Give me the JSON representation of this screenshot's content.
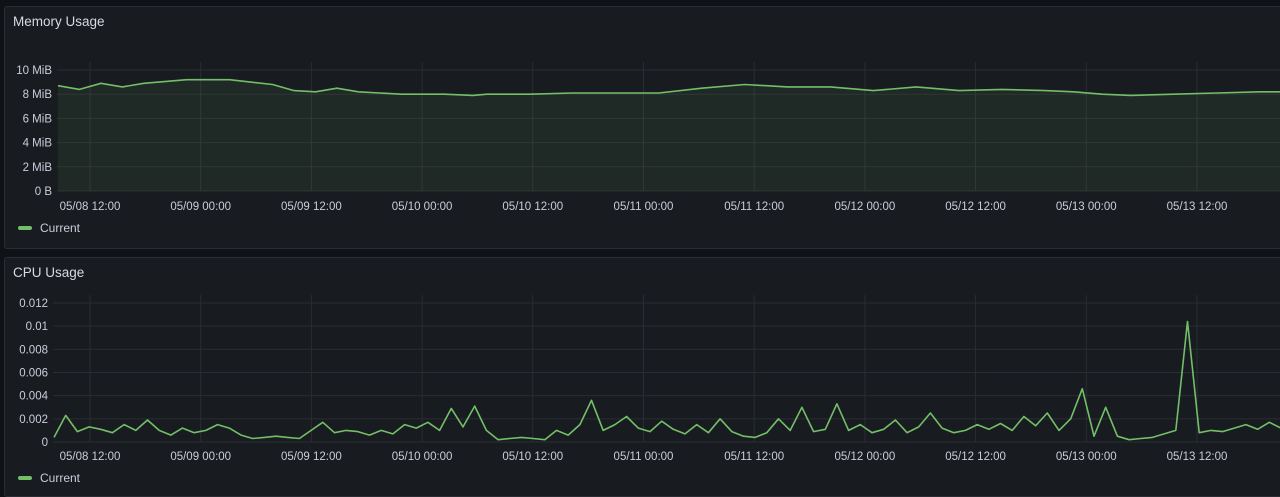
{
  "colors": {
    "series": "#73bf69",
    "grid": "#2a2d33",
    "background": "#181b1f"
  },
  "panels": {
    "memory": {
      "title": "Memory Usage",
      "legend": "Current",
      "chart_data": {
        "type": "area",
        "title": "Memory Usage",
        "series": [
          {
            "name": "Current",
            "x_hours": [
              0,
              3,
              6,
              9,
              12,
              18,
              24,
              30,
              33,
              36,
              39,
              42,
              48,
              54,
              58,
              60,
              66,
              72,
              78,
              84,
              90,
              96,
              102,
              108,
              114,
              120,
              126,
              132,
              138,
              142,
              146,
              150,
              156,
              162,
              168,
              171
            ],
            "values": [
              8.7,
              8.4,
              8.9,
              8.6,
              8.9,
              9.2,
              9.2,
              8.8,
              8.3,
              8.2,
              8.5,
              8.2,
              8.0,
              8.0,
              7.9,
              8.0,
              8.0,
              8.1,
              8.1,
              8.1,
              8.5,
              8.8,
              8.6,
              8.6,
              8.3,
              8.6,
              8.3,
              8.4,
              8.3,
              8.2,
              8.0,
              7.9,
              8.0,
              8.1,
              8.2,
              8.2
            ]
          }
        ],
        "ylim": [
          0,
          10
        ],
        "yticks": [
          "0 B",
          "2 MiB",
          "4 MiB",
          "6 MiB",
          "8 MiB",
          "10 MiB"
        ],
        "xticks": [
          "05/08 12:00",
          "05/09 00:00",
          "05/09 12:00",
          "05/10 00:00",
          "05/10 12:00",
          "05/11 00:00",
          "05/11 12:00",
          "05/12 00:00",
          "05/12 12:00",
          "05/13 00:00",
          "05/13 12:00"
        ],
        "grid": true,
        "legend": "bottom-left"
      }
    },
    "cpu": {
      "title": "CPU Usage",
      "legend": "Current",
      "chart_data": {
        "type": "line",
        "title": "CPU Usage",
        "series": [
          {
            "name": "Current",
            "values": [
              0.0004,
              0.0023,
              0.0009,
              0.0013,
              0.0011,
              0.0008,
              0.0015,
              0.001,
              0.0019,
              0.001,
              0.0006,
              0.0012,
              0.0008,
              0.001,
              0.0015,
              0.0012,
              0.0006,
              0.0003,
              0.0004,
              0.0005,
              0.0004,
              0.0003,
              0.001,
              0.0017,
              0.0008,
              0.001,
              0.0009,
              0.0006,
              0.001,
              0.0007,
              0.0015,
              0.0012,
              0.0017,
              0.001,
              0.0029,
              0.0013,
              0.0031,
              0.001,
              0.0002,
              0.0003,
              0.0004,
              0.0003,
              0.0002,
              0.001,
              0.0006,
              0.0015,
              0.0036,
              0.001,
              0.0015,
              0.0022,
              0.0012,
              0.0009,
              0.0018,
              0.0011,
              0.0007,
              0.0015,
              0.0008,
              0.002,
              0.0009,
              0.0005,
              0.0004,
              0.0008,
              0.002,
              0.001,
              0.003,
              0.0009,
              0.0011,
              0.0033,
              0.001,
              0.0015,
              0.0008,
              0.0011,
              0.0019,
              0.0008,
              0.0013,
              0.0025,
              0.0012,
              0.0008,
              0.001,
              0.0015,
              0.0011,
              0.0016,
              0.001,
              0.0022,
              0.0014,
              0.0025,
              0.001,
              0.002,
              0.0046,
              0.0005,
              0.003,
              0.0005,
              0.0002,
              0.0003,
              0.0004,
              0.0007,
              0.001,
              0.0104,
              0.0008,
              0.001,
              0.0009,
              0.0012,
              0.0015,
              0.0011,
              0.0017,
              0.0012
            ]
          }
        ],
        "ylim": [
          0,
          0.012
        ],
        "yticks": [
          "0",
          "0.002",
          "0.004",
          "0.006",
          "0.008",
          "0.01",
          "0.012"
        ],
        "xticks": [
          "05/08 12:00",
          "05/09 00:00",
          "05/09 12:00",
          "05/10 00:00",
          "05/10 12:00",
          "05/11 00:00",
          "05/11 12:00",
          "05/12 00:00",
          "05/12 12:00",
          "05/13 00:00",
          "05/13 12:00"
        ],
        "grid": true,
        "legend": "bottom-left"
      }
    }
  }
}
